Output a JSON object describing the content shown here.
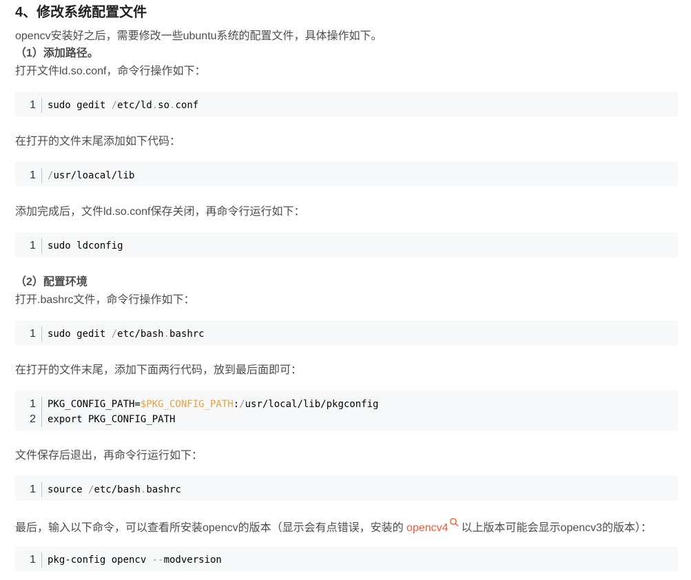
{
  "heading": "4、修改系统配置文件",
  "intro": "opencv安装好之后，需要修改一些ubuntu系统的配置文件，具体操作如下。",
  "step1": {
    "title": "（1）添加路径。",
    "desc": "打开文件ld.so.conf，命令行操作如下：",
    "code1": {
      "ln": "1",
      "parts": [
        "sudo gedit ",
        "/",
        "etc/ld",
        ".",
        "so",
        ".",
        "conf"
      ]
    },
    "desc2": "在打开的文件末尾添加如下代码：",
    "code2": {
      "ln": "1",
      "parts": [
        "/",
        "usr/loacal/lib"
      ]
    },
    "desc3": "添加完成后，文件ld.so.conf保存关闭，再命令行运行如下：",
    "code3": {
      "ln": "1",
      "text": "sudo ldconfig"
    }
  },
  "step2": {
    "title": "（2）配置环境",
    "desc": "打开.bashrc文件，命令行操作如下：",
    "code1": {
      "ln": "1",
      "parts": [
        "sudo gedit ",
        "/",
        "etc/bash",
        ".",
        "bashrc"
      ]
    },
    "desc2": "在打开的文件末尾，添加下面两行代码，放到最后面即可：",
    "code2": {
      "line1": {
        "ln": "1",
        "parts": [
          "PKG_CONFIG_PATH=",
          "$PKG_CONFIG_PATH",
          ":",
          "/",
          "usr/local/lib/pkgconfig"
        ]
      },
      "line2": {
        "ln": "2",
        "text": "export PKG_CONFIG_PATH"
      }
    },
    "desc3": "文件保存后退出，再命令行运行如下：",
    "code3": {
      "ln": "1",
      "parts": [
        "source ",
        "/",
        "etc/bash",
        ".",
        "bashrc"
      ]
    }
  },
  "final": {
    "text_before": "最后，输入以下命令，可以查看所安装opencv的版本（显示会有点错误，安装的 ",
    "link": "opencv4",
    "text_after": "以上版本可能会显示opencv3的版本）：",
    "code": {
      "ln": "1",
      "parts": [
        "pkg-config opencv ",
        "--",
        "modversion"
      ]
    }
  },
  "colors": {
    "link": "#fc5531",
    "code_bg": "#f6f8fa",
    "variable": "#e6a23c",
    "operator": "#999999"
  }
}
